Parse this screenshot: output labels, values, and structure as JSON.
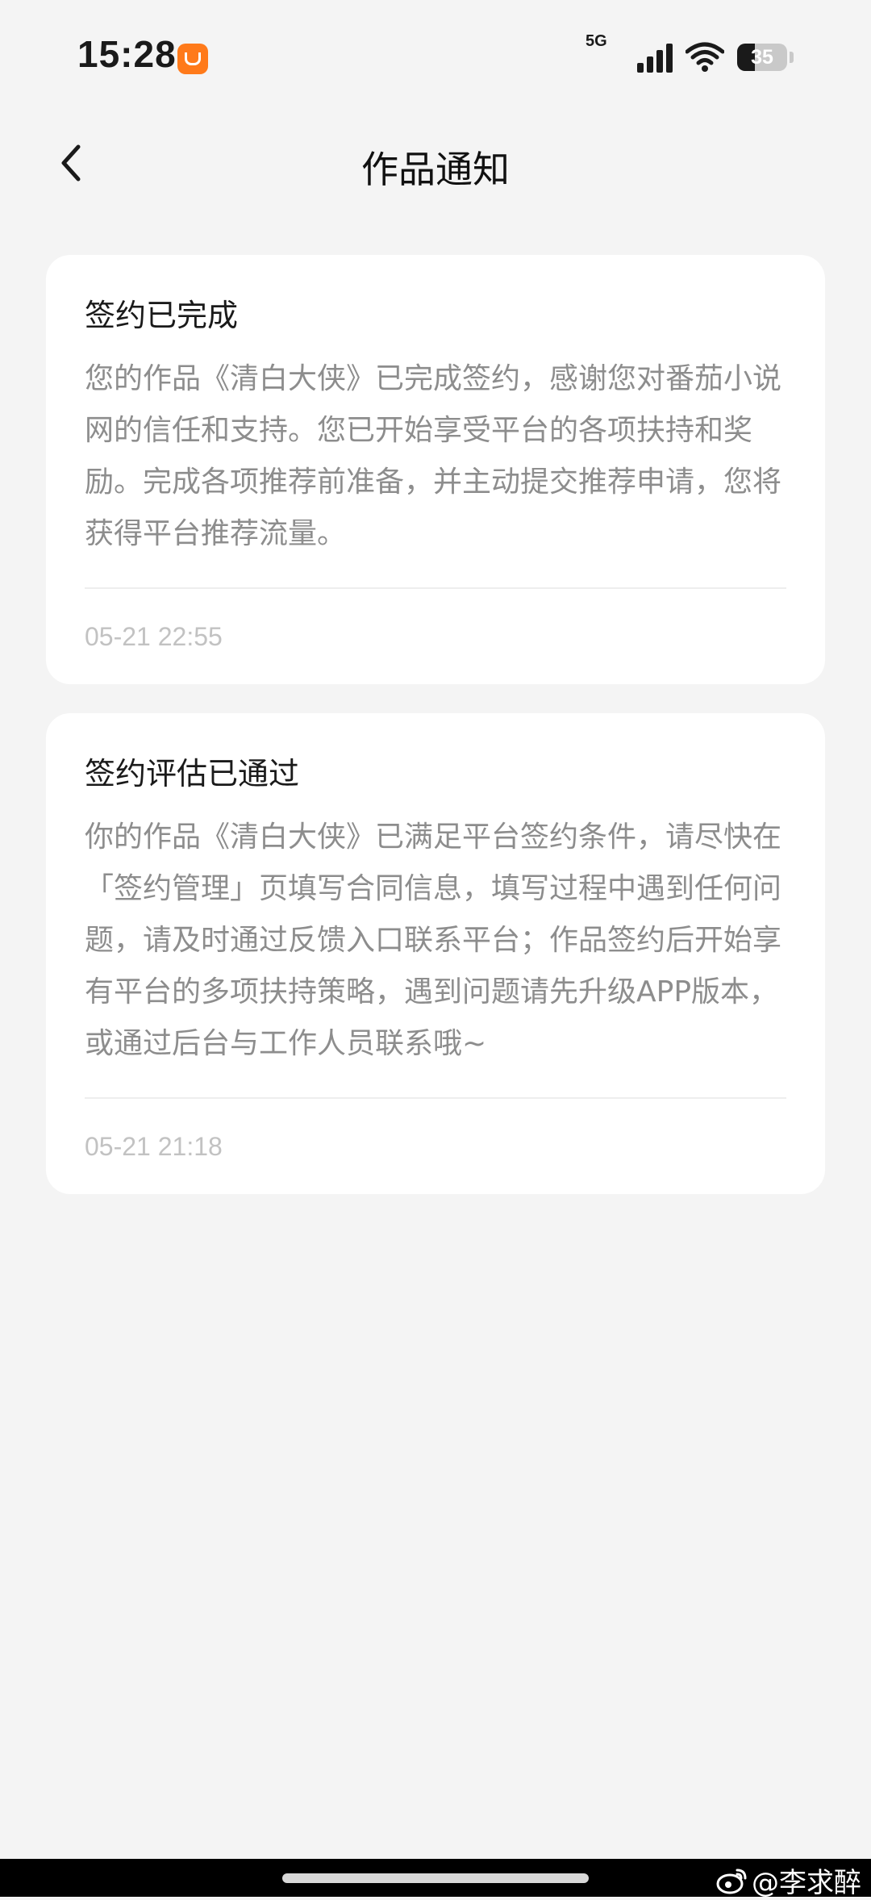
{
  "status_bar": {
    "time": "15:28",
    "network": "5G",
    "battery": "35"
  },
  "header": {
    "title": "作品通知"
  },
  "notifications": [
    {
      "title": "签约已完成",
      "body": "您的作品《清白大侠》已完成签约，感谢您对番茄小说网的信任和支持。您已开始享受平台的各项扶持和奖励。完成各项推荐前准备，并主动提交推荐申请，您将获得平台推荐流量。",
      "time": "05-21 22:55"
    },
    {
      "title": "签约评估已通过",
      "body": "你的作品《清白大侠》已满足平台签约条件，请尽快在「签约管理」页填写合同信息，填写过程中遇到任何问题，请及时通过反馈入口联系平台；作品签约后开始享有平台的多项扶持策略，遇到问题请先升级APP版本，或通过后台与工作人员联系哦~",
      "time": "05-21 21:18"
    }
  ],
  "watermark": {
    "text": "@李求醉"
  }
}
